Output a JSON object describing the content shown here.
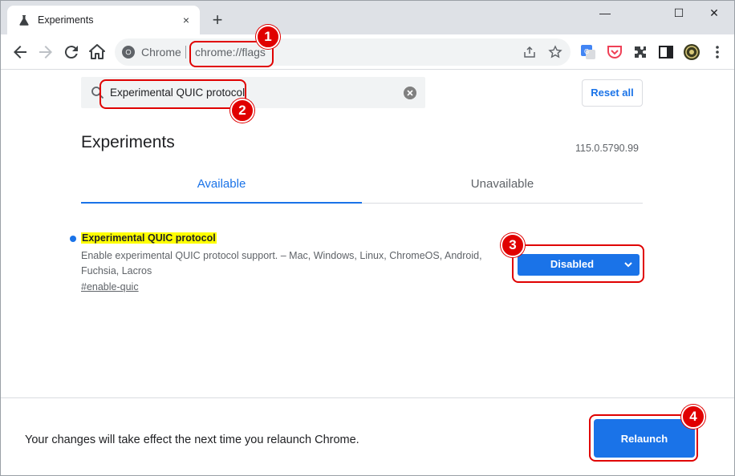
{
  "tab": {
    "title": "Experiments",
    "close": "×"
  },
  "newtab": "+",
  "window_controls": {
    "minimize": "—",
    "maximize": "☐",
    "close": "✕"
  },
  "omnibox": {
    "chip": "Chrome",
    "url": "chrome://flags"
  },
  "search": {
    "value": "Experimental QUIC protocol"
  },
  "reset_all": "Reset all",
  "page_title": "Experiments",
  "version": "115.0.5790.99",
  "tabs": [
    {
      "label": "Available"
    },
    {
      "label": "Unavailable"
    }
  ],
  "flag": {
    "name": "Experimental QUIC protocol",
    "description": "Enable experimental QUIC protocol support. – Mac, Windows, Linux, ChromeOS, Android, Fuchsia, Lacros",
    "link": "#enable-quic",
    "selected": "Disabled"
  },
  "relaunch": {
    "message": "Your changes will take effect the next time you relaunch Chrome.",
    "button": "Relaunch"
  },
  "annotations": [
    "1",
    "2",
    "3",
    "4"
  ],
  "colors": {
    "accent": "#1a73e8",
    "highlight": "#ffff00",
    "annotation": "#e00000"
  }
}
